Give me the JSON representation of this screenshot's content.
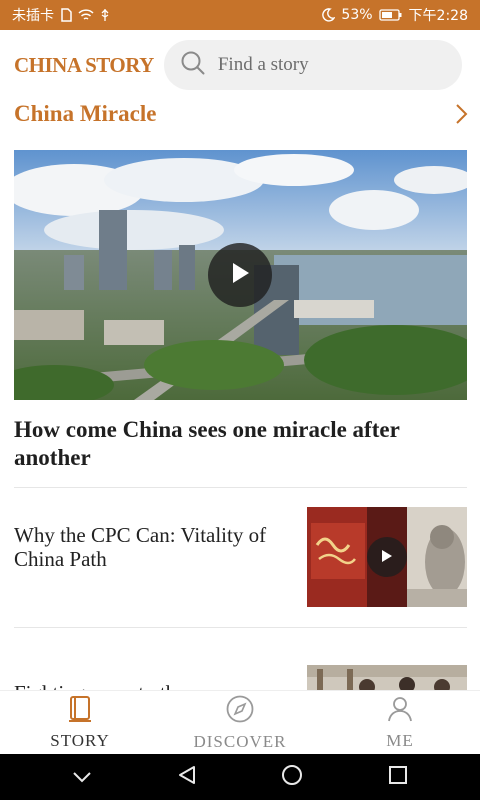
{
  "status_bar": {
    "carrier": "未插卡",
    "battery": "53%",
    "time": "下午2:28"
  },
  "header": {
    "brand": "CHINA STORY",
    "search_placeholder": "Find a story"
  },
  "section": {
    "title": "China Miracle"
  },
  "hero": {
    "title": "How come China sees one miracle after another"
  },
  "stories": [
    {
      "title": "Why the CPC Can: Vitality of China Path",
      "thumb_caption": "中国共产党为什么能"
    },
    {
      "title": "Fighting poverty the"
    }
  ],
  "bottom_nav": [
    {
      "label": "STORY",
      "icon": "book-icon",
      "active": true
    },
    {
      "label": "DISCOVER",
      "icon": "compass-icon",
      "active": false
    },
    {
      "label": "ME",
      "icon": "person-icon",
      "active": false
    }
  ],
  "colors": {
    "accent": "#c6732a"
  }
}
